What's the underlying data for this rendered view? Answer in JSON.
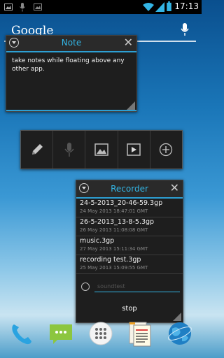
{
  "statusbar": {
    "time": "17:13"
  },
  "google": {
    "logo": "Google"
  },
  "note": {
    "title": "Note",
    "body": "take notes while floating above any other app."
  },
  "toolbar": {
    "buttons": [
      "pencil-icon",
      "microphone-icon",
      "image-icon",
      "video-play-icon",
      "add-icon"
    ]
  },
  "recorder": {
    "title": "Recorder",
    "items": [
      {
        "name": "24-5-2013_20-46-59.3gp",
        "date": "24 May 2013 18:47:01 GMT"
      },
      {
        "name": "26-5-2013_13-8-5.3gp",
        "date": "26 May 2013 11:08:08 GMT"
      },
      {
        "name": "music.3gp",
        "date": "27 May 2013 15:11:34 GMT"
      },
      {
        "name": "recording test.3gp",
        "date": "25 May 2013 15:09:55 GMT"
      }
    ],
    "input_placeholder": "soundtest",
    "stop_label": "stop"
  },
  "dock": {
    "apps": [
      "phone-icon",
      "messaging-icon",
      "app-drawer-icon",
      "notes-app-icon",
      "browser-icon"
    ]
  },
  "colors": {
    "accent": "#33b5e5",
    "window_bg": "#1e1e1e"
  }
}
